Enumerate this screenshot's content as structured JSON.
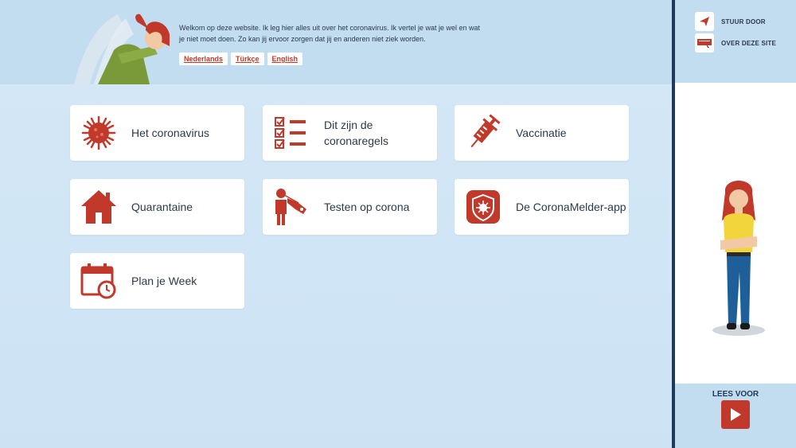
{
  "header": {
    "welcome_text": "Welkom op deze website. Ik leg hier alles uit over het coronavirus. Ik vertel je wat je wel en wat je niet moet doen. Zo kan jij ervoor zorgen dat jij en anderen niet ziek worden.",
    "languages": [
      "Nederlands",
      "Türkçe",
      "English"
    ]
  },
  "tiles": [
    {
      "label": "Het coronavirus",
      "icon": "virus-icon"
    },
    {
      "label": "Dit zijn de coronaregels",
      "icon": "checklist-icon"
    },
    {
      "label": "Vaccinatie",
      "icon": "syringe-icon"
    },
    {
      "label": "Quarantaine",
      "icon": "house-icon"
    },
    {
      "label": "Testen op corona",
      "icon": "swab-test-icon"
    },
    {
      "label": "De CoronaMelder-app",
      "icon": "app-shield-icon"
    },
    {
      "label": "Plan je Week",
      "icon": "calendar-clock-icon"
    }
  ],
  "sidebar": {
    "share_label": "STUUR DOOR",
    "about_label": "OVER DEZE SITE",
    "read_aloud_label": "LEES VOOR"
  },
  "colors": {
    "accent": "#c0392b",
    "header_bg": "#c2dcf0",
    "body_bg": "#cfe4f4",
    "divider": "#1f3a57"
  }
}
